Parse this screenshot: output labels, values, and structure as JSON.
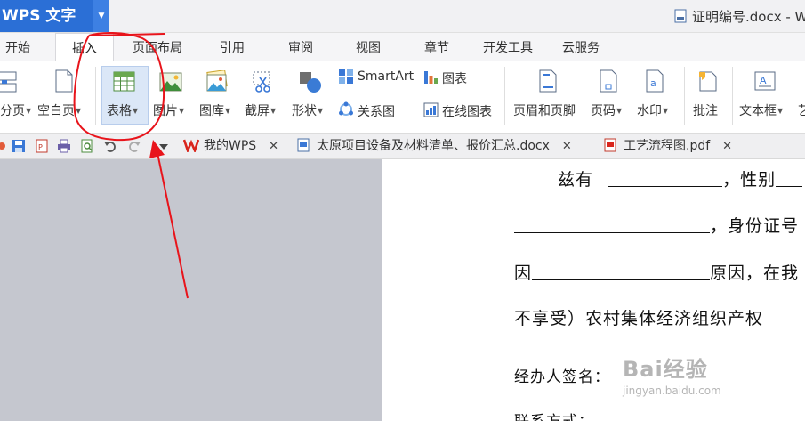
{
  "window": {
    "app_label": "WPS 文字",
    "document_title": "证明编号.docx - W"
  },
  "menu_tabs": [
    {
      "label": "开始"
    },
    {
      "label": "插入",
      "active": true
    },
    {
      "label": "页面布局"
    },
    {
      "label": "引用"
    },
    {
      "label": "审阅"
    },
    {
      "label": "视图"
    },
    {
      "label": "章节"
    },
    {
      "label": "开发工具"
    },
    {
      "label": "云服务"
    }
  ],
  "ribbon": {
    "page_break": "分页",
    "blank_page": "空白页",
    "table": "表格",
    "picture": "图片",
    "gallery": "图库",
    "screenshot": "截屏",
    "shape": "形状",
    "smartart": "SmartArt",
    "relation_chart": "关系图",
    "chart": "图表",
    "online_chart": "在线图表",
    "header_footer": "页眉和页脚",
    "page_number": "页码",
    "watermark": "水印",
    "comment": "批注",
    "textbox": "文本框",
    "art_text": "艺"
  },
  "doc_tabs": [
    {
      "label": "我的WPS"
    },
    {
      "label": "太原项目设备及材料清单、报价汇总.docx"
    },
    {
      "label": "工艺流程图.pdf"
    }
  ],
  "document": {
    "line1_a": "兹有",
    "line1_b": "，性别",
    "line2_b": "，身份证号",
    "line3_a": "因",
    "line3_b": "原因，在我",
    "line4": "不享受）农村集体经济组织产权",
    "line5": "经办人签名：",
    "line6": "联系方式："
  },
  "site_watermark": {
    "brand": "Bai经验",
    "url": "jingyan.baidu.com"
  },
  "colors": {
    "app_blue": "#2b6fd6",
    "annotation_red": "#e8141b"
  }
}
